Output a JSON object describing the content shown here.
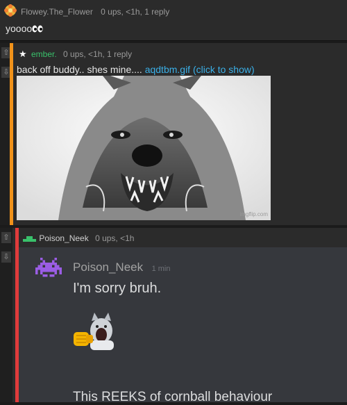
{
  "comments": [
    {
      "user": "Flowey.The_Flower",
      "meta": "0 ups, <1h, 1 reply",
      "text": "yoooo",
      "emoji": "eyes-icon"
    },
    {
      "user": "ember.",
      "meta": "0 ups, <1h, 1 reply",
      "text": "back off buddy.. shes mine....",
      "link": "aqdtbm.gif (click to show)",
      "image_caption": "imgflip.com",
      "accent": "#f0921a"
    },
    {
      "user": "Poison_Neek",
      "meta": "0 ups, <1h",
      "accent": "#e03b3b",
      "embed": {
        "username": "Poison_Neek",
        "time": "1 min",
        "message1": "I'm sorry bruh.",
        "message2": "This REEKS of cornball behaviour"
      }
    }
  ],
  "icons": {
    "upvote": "arrow-up-icon",
    "downvote": "arrow-down-icon",
    "flowey_avatar": "flower-icon",
    "ember_badge": "star-icon",
    "neek_badge": "green-hat-icon",
    "discord_avatar": "space-invader-icon",
    "sticker": "cat-fist-sticker-icon"
  },
  "colors": {
    "link": "#3bb0e8",
    "user_green": "#39c16b",
    "discord_avatar": "#9b5de5"
  }
}
